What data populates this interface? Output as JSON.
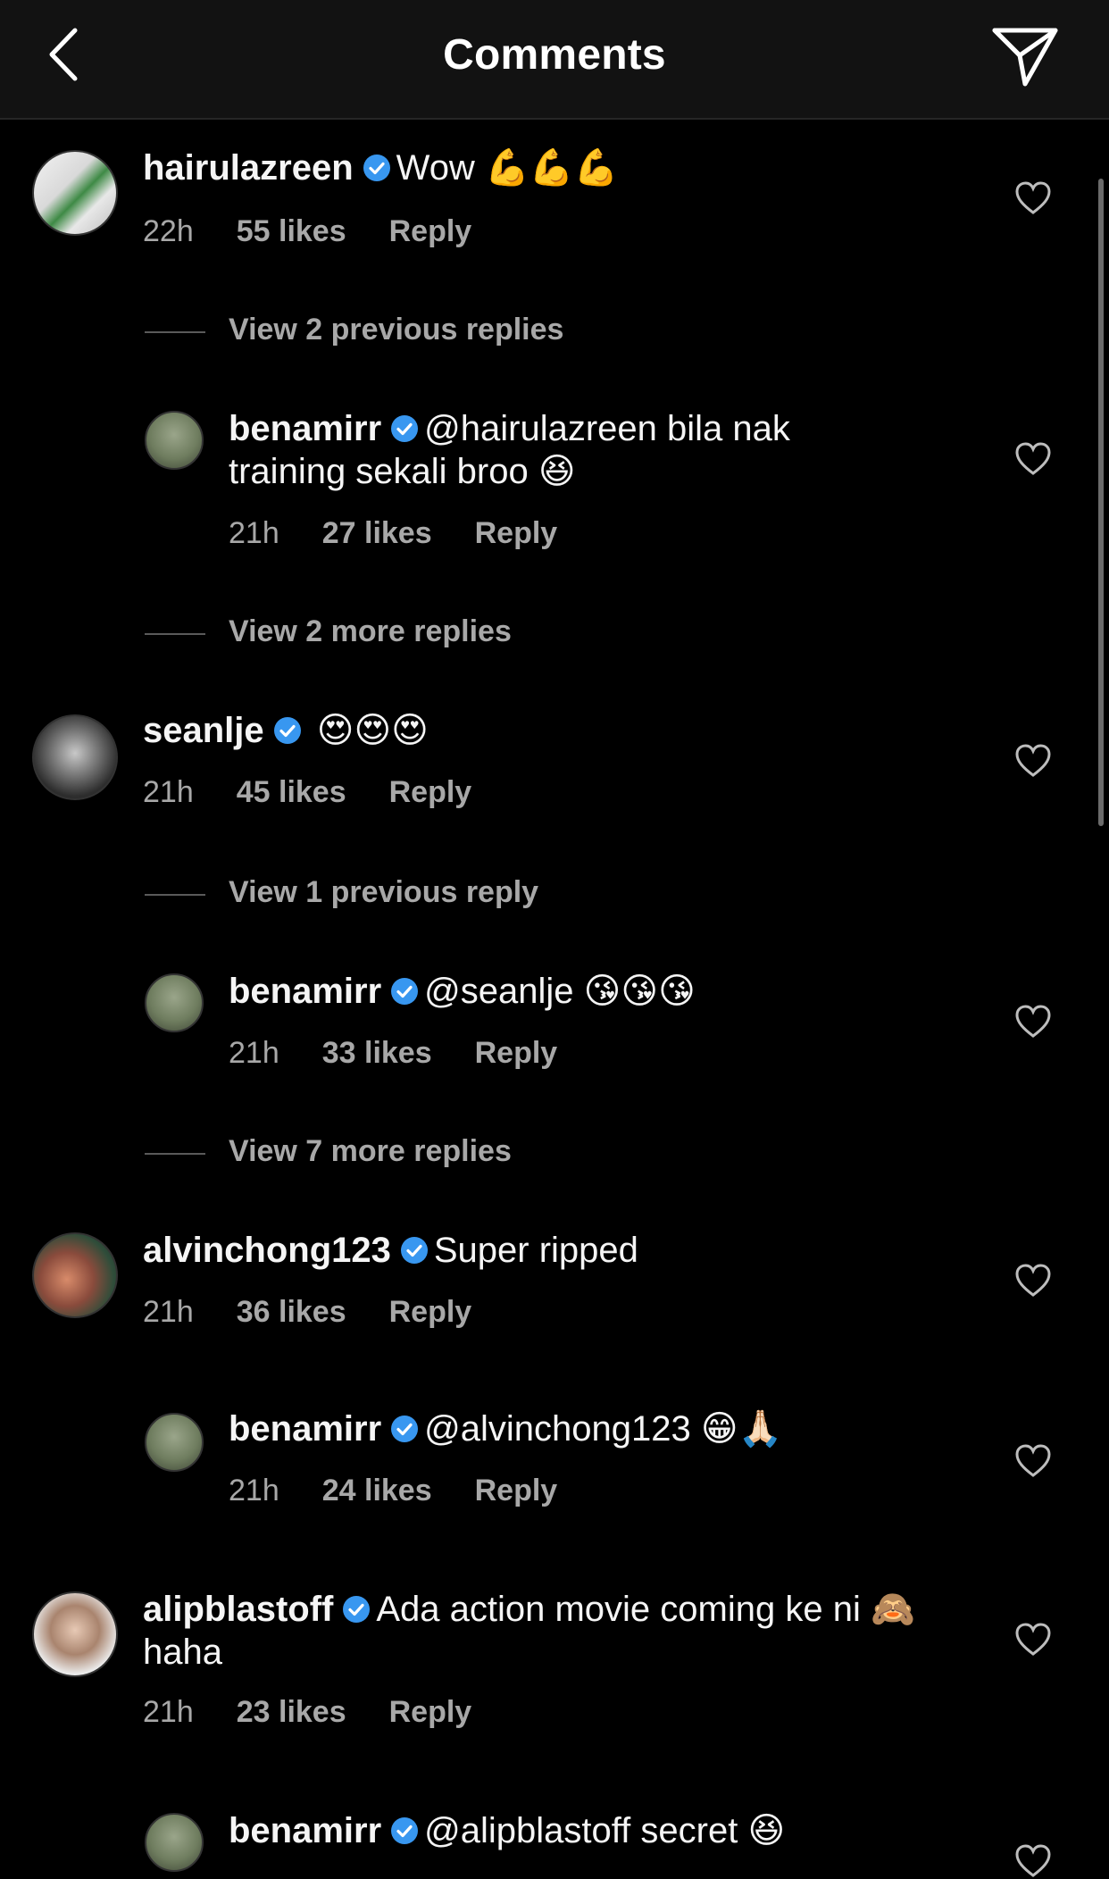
{
  "header": {
    "title": "Comments"
  },
  "comments": [
    {
      "username": "hairulazreen",
      "text": "Wow",
      "emoji": "💪💪💪",
      "time": "22h",
      "likes": "55 likes",
      "reply": "Reply"
    },
    {
      "username": "benamirr",
      "text": "@hairulazreen bila nak training sekali broo",
      "emoji": "😆",
      "time": "21h",
      "likes": "27 likes",
      "reply": "Reply"
    },
    {
      "username": "seanlje",
      "text": "",
      "emoji": "😍😍😍",
      "time": "21h",
      "likes": "45 likes",
      "reply": "Reply"
    },
    {
      "username": "benamirr",
      "text": "@seanlje",
      "emoji": "😘😘😘",
      "time": "21h",
      "likes": "33 likes",
      "reply": "Reply"
    },
    {
      "username": "alvinchong123",
      "text": "Super ripped",
      "emoji": "",
      "time": "21h",
      "likes": "36 likes",
      "reply": "Reply"
    },
    {
      "username": "benamirr",
      "text": "@alvinchong123",
      "emoji": "😁🙏🏻",
      "time": "21h",
      "likes": "24 likes",
      "reply": "Reply"
    },
    {
      "username": "alipblastoff",
      "text": "Ada action movie coming ke ni",
      "emoji": "🙈",
      "text2": "haha",
      "time": "21h",
      "likes": "23 likes",
      "reply": "Reply"
    },
    {
      "username": "benamirr",
      "text": "@alipblastoff secret",
      "emoji": "😆"
    }
  ],
  "view_links": [
    "View 2 previous replies",
    "View 2 more replies",
    "View 1 previous reply",
    "View 7 more replies"
  ],
  "colors": {
    "background": "#000000",
    "header": "#121212",
    "verified": "#3897f0",
    "secondary_text": "#a8a8a8"
  },
  "icons": [
    "back-icon",
    "send-icon",
    "verified-icon",
    "heart-icon"
  ]
}
